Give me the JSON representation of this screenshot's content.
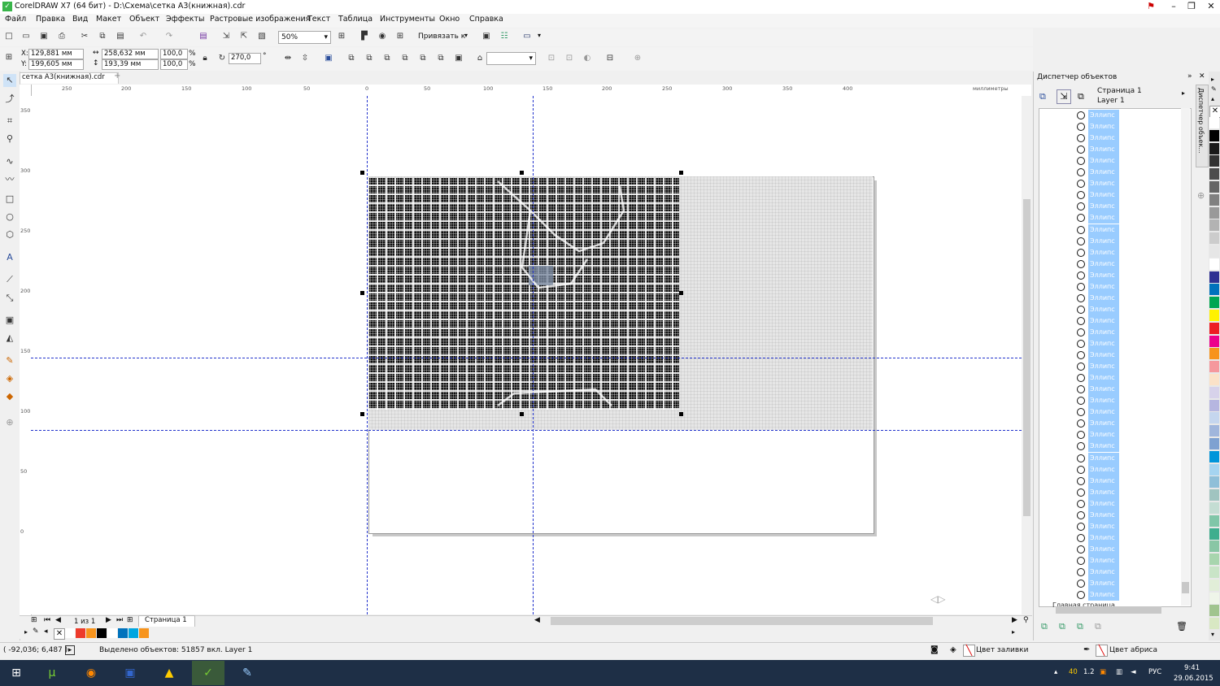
{
  "window": {
    "title": "CorelDRAW X7 (64 бит) - D:\\Схема\\сетка А3(книжная).cdr",
    "controls": [
      "⚑",
      "–",
      "❐",
      "✕"
    ]
  },
  "menu": [
    "Файл",
    "Правка",
    "Вид",
    "Макет",
    "Объект",
    "Эффекты",
    "Растровые изображения",
    "Текст",
    "Таблица",
    "Инструменты",
    "Окно",
    "Справка"
  ],
  "standard_toolbar": {
    "zoom": "50%",
    "snap_label": "Привязать к"
  },
  "property_bar": {
    "x": "129,881 мм",
    "y": "199,605 мм",
    "x_label": "X:",
    "y_label": "Y:",
    "width": "258,632 мм",
    "height": "193,39 мм",
    "scale_w": "100,0",
    "scale_h": "100,0",
    "percent": "%",
    "rotation": "270,0",
    "degree": "°"
  },
  "document": {
    "tab": "сетка А3(книжная).cdr",
    "ruler_units": "миллиметры",
    "h_ruler_ticks": [
      "250",
      "200",
      "150",
      "100",
      "50",
      "0",
      "50",
      "100",
      "150",
      "200",
      "250",
      "300",
      "350",
      "400"
    ],
    "v_ruler_ticks": [
      "350",
      "300",
      "250",
      "200",
      "150",
      "100",
      "50",
      "0"
    ],
    "page_counter": "1 из 1",
    "page_tab": "Страница 1"
  },
  "status": {
    "cursor": "( -92,036; 6,487 )",
    "selection": "Выделено объектов: 51857 вкл. Layer 1",
    "fill_label": "Цвет заливки",
    "outline_label": "Цвет абриса"
  },
  "docker": {
    "title": "Диспетчер объектов",
    "side_tab": "Диспетчер объек...",
    "page": "Страница 1",
    "layer": "Layer 1",
    "item_label": "Эллипс",
    "item_count": 43,
    "footer_item": "Главная страница"
  },
  "colors": {
    "selection_highlight": "#99ccff",
    "guide": "#2233cc",
    "taskbar": "#1e2f46",
    "palette_right": [
      "#ffffff",
      "#000000",
      "#1a1a1a",
      "#333333",
      "#4d4d4d",
      "#666666",
      "#808080",
      "#999999",
      "#b3b3b3",
      "#cccccc",
      "#e6e6e6",
      "#ffffff",
      "#2e3192",
      "#0072bc",
      "#00a651",
      "#fff200",
      "#ed1c24",
      "#ec008c",
      "#f7941d",
      "#f5989d",
      "#fbe2c8",
      "#d7d2ea",
      "#b6b6e0",
      "#c5d6ee",
      "#a0b6dc",
      "#7ea1d1",
      "#0095da",
      "#a5d4f0",
      "#8fbfd8",
      "#a0c4c0",
      "#c4ddd3",
      "#80c6a8",
      "#3fae8e",
      "#89c6a5",
      "#a8d5ae",
      "#c9e4c7",
      "#e1eed8",
      "#eff5e9",
      "#a0c48e",
      "#d8e8c3"
    ],
    "palette_bottom": [
      "#ffffff",
      "#ed3b2c",
      "#f7941d",
      "#000000",
      "#ffffff",
      "#0072bc",
      "#00a6e0",
      "#f7941d"
    ]
  },
  "taskbar": {
    "apps": [
      "windows-start",
      "utorrent",
      "firefox",
      "save-disk",
      "aimp",
      "coreldraw",
      "paint"
    ],
    "tray_text": "РУС",
    "time": "9:41",
    "date": "29.06.2015",
    "tray_nums": [
      "40",
      "1.2"
    ]
  }
}
